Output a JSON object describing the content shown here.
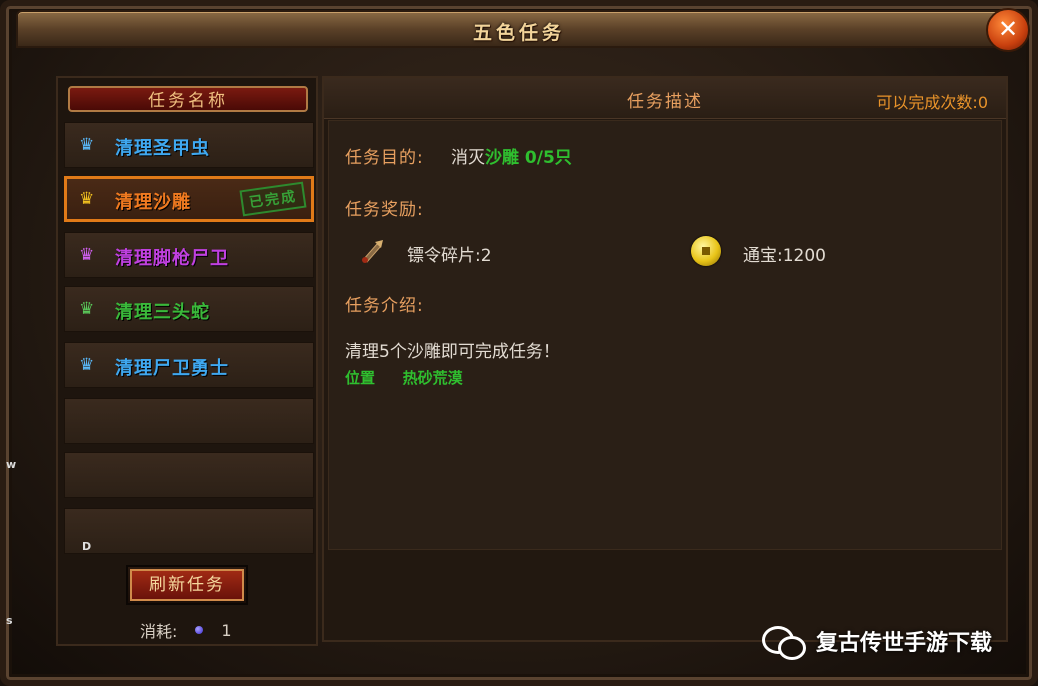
{
  "window": {
    "title": "五色任务",
    "close_label": "✕"
  },
  "edge_text": {
    "left_w": "w",
    "left_s": "s"
  },
  "quest_list": {
    "header": "任务名称",
    "items": [
      {
        "name": "清理圣甲虫",
        "color": "#3fa8f0",
        "icon_color": "#5ab8f8",
        "selected": false
      },
      {
        "name": "清理沙雕",
        "color": "#f07a20",
        "icon_color": "#f0c020",
        "selected": true,
        "stamp": "已完成"
      },
      {
        "name": "清理脚枪尸卫",
        "color": "#c040e0",
        "icon_color": "#d060f0",
        "selected": false
      },
      {
        "name": "清理三头蛇",
        "color": "#3ab83a",
        "icon_color": "#5ac85a",
        "selected": false
      },
      {
        "name": "清理尸卫勇士",
        "color": "#3fa8f0",
        "icon_color": "#5ab8f8",
        "selected": false
      }
    ],
    "footer_mark": "D",
    "refresh_button": "刷新任务",
    "cost_label": "消耗:",
    "cost_value": "1"
  },
  "description": {
    "title": "任务描述",
    "complete_count": "可以完成次数:0",
    "objective_label": "任务目的:",
    "objective_action": "消灭",
    "objective_target": "沙雕 0/5只",
    "reward_label": "任务奖励:",
    "reward_1": "镖令碎片:2",
    "reward_2": "通宝:1200",
    "intro_label": "任务介绍:",
    "intro_text": "清理5个沙雕即可完成任务！",
    "location_label": "位置",
    "location_value": "热砂荒漠"
  },
  "watermark": {
    "text": "复古传世手游下载",
    "icon": "wechat-icon"
  }
}
